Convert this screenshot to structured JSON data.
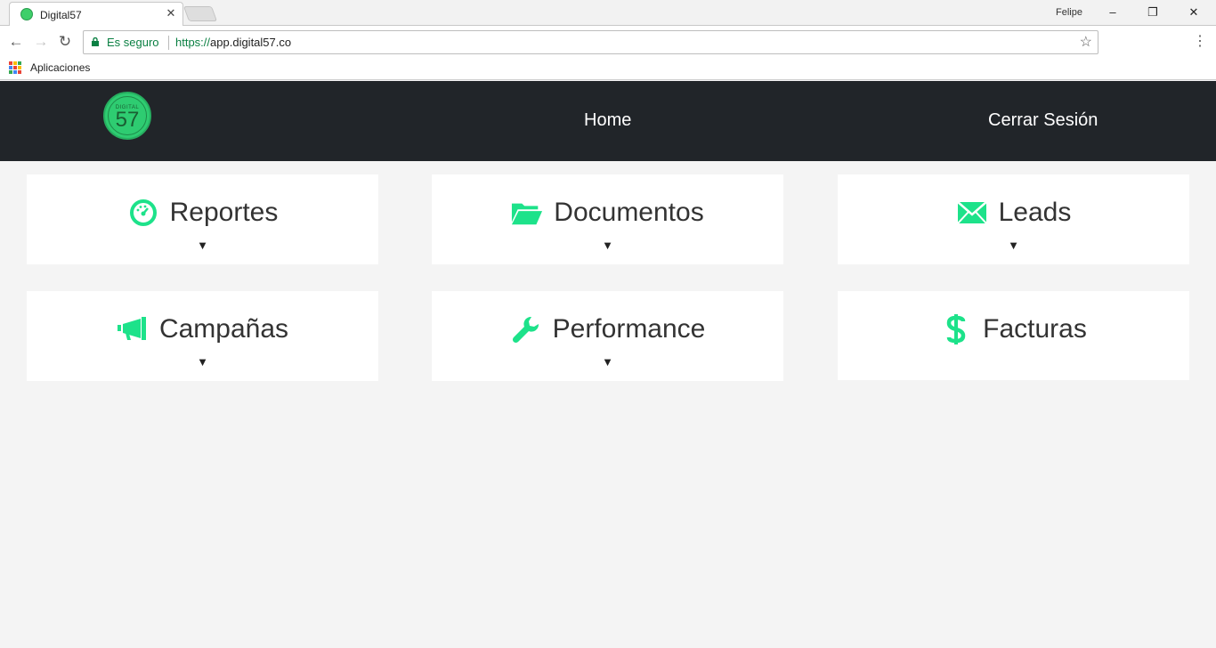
{
  "browser": {
    "tab_title": "Digital57",
    "tab_close": "✕",
    "user_name": "Felipe",
    "window_controls": {
      "minimize": "–",
      "restore": "❐",
      "close": "✕"
    },
    "nav": {
      "back": "←",
      "forward": "→",
      "reload": "↻"
    },
    "secure_label": "Es seguro",
    "url_scheme": "https://",
    "url_host": "app.digital57.co",
    "star": "☆",
    "menu": "⋮",
    "bookmarks_apps_label": "Aplicaciones"
  },
  "header": {
    "logo_small": "DIGITAL",
    "logo_big": "57",
    "nav_home": "Home",
    "nav_logout": "Cerrar Sesión"
  },
  "colors": {
    "accent": "#1de28a",
    "header_bg": "#212529",
    "page_bg": "#f4f4f4"
  },
  "cards": [
    {
      "title": "Reportes",
      "icon": "dashboard-icon",
      "arrow": "▼"
    },
    {
      "title": "Documentos",
      "icon": "folder-open-icon",
      "arrow": "▼"
    },
    {
      "title": "Leads",
      "icon": "envelope-icon",
      "arrow": "▼"
    },
    {
      "title": "Campañas",
      "icon": "megaphone-icon",
      "arrow": "▼"
    },
    {
      "title": "Performance",
      "icon": "wrench-icon",
      "arrow": "▼"
    },
    {
      "title": "Facturas",
      "icon": "dollar-icon",
      "arrow": ""
    }
  ]
}
